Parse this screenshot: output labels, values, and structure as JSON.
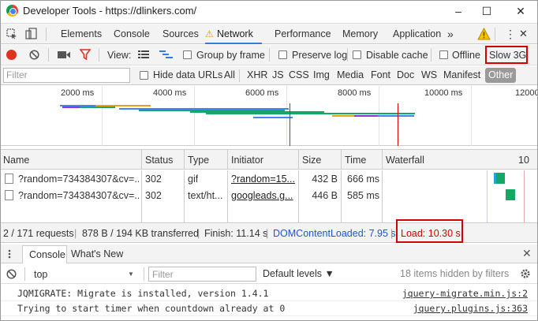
{
  "window": {
    "title": "Developer Tools - https://dlinkers.com/",
    "buttons": {
      "minimize": "–",
      "maximize": "☐",
      "close": "✕"
    }
  },
  "tabs": [
    "Elements",
    "Console",
    "Sources",
    "Network",
    "Performance",
    "Memory",
    "Application"
  ],
  "active_tab": "Network",
  "more_tabs": "»",
  "menu_glyph": "⋮",
  "toolbar": {
    "view_label": "View:",
    "group_by_frame": "Group by frame",
    "preserve_log": "Preserve log",
    "disable_cache": "Disable cache",
    "offline": "Offline",
    "throttle": "Slow 3G"
  },
  "filter": {
    "placeholder": "Filter",
    "hide_data_urls": "Hide data URLs",
    "types": [
      "All",
      "XHR",
      "JS",
      "CSS",
      "Img",
      "Media",
      "Font",
      "Doc",
      "WS",
      "Manifest",
      "Other"
    ],
    "active_type": "Other"
  },
  "overview": {
    "ticks": [
      "2000 ms",
      "4000 ms",
      "6000 ms",
      "8000 ms",
      "10000 ms",
      "12000"
    ]
  },
  "table": {
    "headers": {
      "name": "Name",
      "status": "Status",
      "type": "Type",
      "initiator": "Initiator",
      "size": "Size",
      "time": "Time",
      "waterfall": "Waterfall",
      "waterfall_tick": "10"
    },
    "rows": [
      {
        "name": "?random=734384307&cv=...",
        "status": "302",
        "type": "gif",
        "initiator": "?random=15...",
        "size": "432 B",
        "time": "666 ms"
      },
      {
        "name": "?random=734384307&cv=...",
        "status": "302",
        "type": "text/ht...",
        "initiator": "googleads.g...",
        "size": "446 B",
        "time": "585 ms"
      }
    ]
  },
  "status": {
    "requests": "2 / 171 requests",
    "transferred": "878 B / 194 KB transferred",
    "finish": "Finish: 11.14 s",
    "dom_content_loaded": "DOMContentLoaded: 7.95 s",
    "load": "Load: 10.30 s",
    "divider": "|"
  },
  "drawer": {
    "tabs": [
      "Console",
      "What's New"
    ],
    "close": "✕",
    "context": "top",
    "filter_placeholder": "Filter",
    "levels": "Default levels ▼",
    "hidden_count": "18 items hidden by filters"
  },
  "console": [
    {
      "message": "JQMIGRATE: Migrate is installed, version 1.4.1",
      "source": "jquery-migrate.min.js:2"
    },
    {
      "message": "Trying to start timer when countdown already at 0",
      "source": "jquery.plugins.js:363"
    }
  ],
  "colors": {
    "accent": "#3879d9",
    "highlight": "#d40000",
    "dom_blue": "#1a57d6",
    "load_red": "#d40000",
    "record_red": "#e0301e"
  }
}
